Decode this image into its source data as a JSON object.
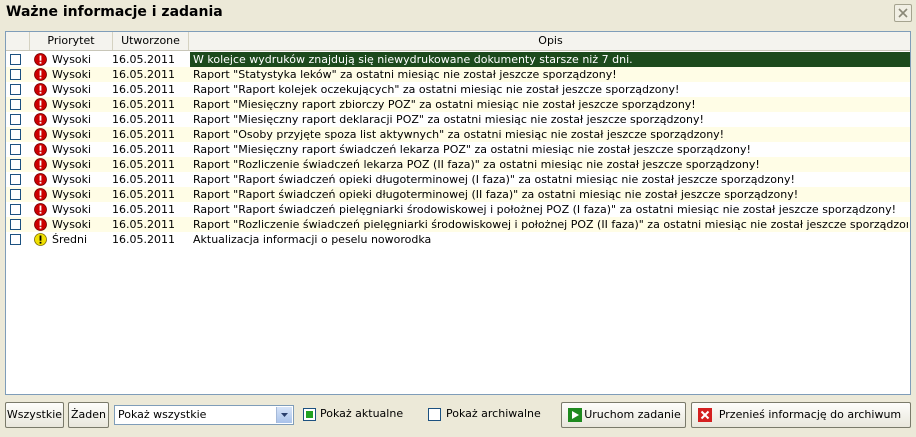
{
  "window": {
    "title": "Ważne informacje i zadania"
  },
  "columns": [
    "Priorytet",
    "Utworzone",
    "Opis"
  ],
  "colors": {
    "selected_row": "#1c4a1c",
    "alt_row": "#fffde6",
    "high_priority": "#cc0000",
    "medium_priority": "#f0e000"
  },
  "rows": [
    {
      "priority": "Wysoki",
      "icon": "error-icon",
      "date": "16.05.2011",
      "desc": "W kolejce wydruków znajdują się niewydrukowane dokumenty starsze niż 7 dni."
    },
    {
      "priority": "Wysoki",
      "icon": "error-icon",
      "date": "16.05.2011",
      "desc": "Raport \"Statystyka leków\" za ostatni miesiąc nie został jeszcze sporządzony!"
    },
    {
      "priority": "Wysoki",
      "icon": "error-icon",
      "date": "16.05.2011",
      "desc": "Raport \"Raport kolejek oczekujących\" za ostatni miesiąc nie został jeszcze sporządzony!"
    },
    {
      "priority": "Wysoki",
      "icon": "error-icon",
      "date": "16.05.2011",
      "desc": "Raport \"Miesięczny raport zbiorczy POZ\" za ostatni miesiąc nie został jeszcze sporządzony!"
    },
    {
      "priority": "Wysoki",
      "icon": "error-icon",
      "date": "16.05.2011",
      "desc": "Raport \"Miesięczny raport deklaracji POZ\" za ostatni miesiąc nie został jeszcze sporządzony!"
    },
    {
      "priority": "Wysoki",
      "icon": "error-icon",
      "date": "16.05.2011",
      "desc": "Raport \"Osoby przyjęte spoza list aktywnych\" za ostatni miesiąc nie został jeszcze sporządzony!"
    },
    {
      "priority": "Wysoki",
      "icon": "error-icon",
      "date": "16.05.2011",
      "desc": "Raport \"Miesięczny raport świadczeń lekarza POZ\" za ostatni miesiąc nie został jeszcze sporządzony!"
    },
    {
      "priority": "Wysoki",
      "icon": "error-icon",
      "date": "16.05.2011",
      "desc": "Raport \"Rozliczenie świadczeń lekarza POZ (II faza)\" za ostatni miesiąc nie został jeszcze sporządzony!"
    },
    {
      "priority": "Wysoki",
      "icon": "error-icon",
      "date": "16.05.2011",
      "desc": "Raport \"Raport świadczeń opieki długoterminowej (I faza)\" za ostatni miesiąc nie został jeszcze sporządzony!"
    },
    {
      "priority": "Wysoki",
      "icon": "error-icon",
      "date": "16.05.2011",
      "desc": "Raport \"Raport świadczeń opieki długoterminowej (II faza)\" za ostatni miesiąc nie został jeszcze sporządzony!"
    },
    {
      "priority": "Wysoki",
      "icon": "error-icon",
      "date": "16.05.2011",
      "desc": "Raport \"Raport świadczeń pielęgniarki środowiskowej i położnej POZ (I faza)\" za ostatni miesiąc nie został jeszcze sporządzony!"
    },
    {
      "priority": "Wysoki",
      "icon": "error-icon",
      "date": "16.05.2011",
      "desc": "Raport \"Rozliczenie świadczeń pielęgniarki środowiskowej i położnej POZ (II faza)\" za ostatni miesiąc nie został jeszcze sporządzony!"
    },
    {
      "priority": "Średni",
      "icon": "warning-icon",
      "date": "16.05.2011",
      "desc": "Aktualizacja informacji o peselu noworodka"
    }
  ],
  "selected_row": 0,
  "toolbar": {
    "all_label": "Wszystkie",
    "none_label": "Żaden",
    "filter_value": "Pokaż wszystkie",
    "current_label": "Pokaż aktualne",
    "current_checked": true,
    "archived_label": "Pokaż archiwalne",
    "archived_checked": false,
    "run_label": "Uruchom zadanie",
    "archive_label": "Przenieś informację do archiwum"
  }
}
